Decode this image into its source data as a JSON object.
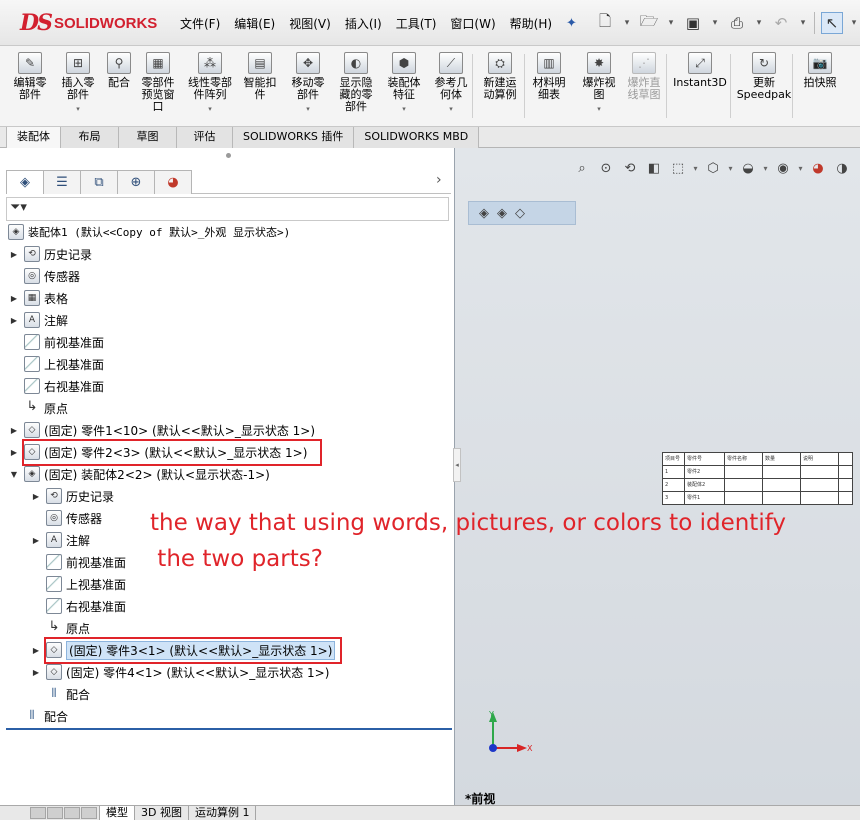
{
  "app": {
    "logo_ds": "DS",
    "logo_name": "SOLIDWORKS"
  },
  "menu": [
    "文件(F)",
    "编辑(E)",
    "视图(V)",
    "插入(I)",
    "工具(T)",
    "窗口(W)",
    "帮助(H)"
  ],
  "commands": [
    {
      "label": "编辑零\n部件",
      "dropdown": false,
      "enabled": true
    },
    {
      "label": "插入零\n部件",
      "dropdown": true,
      "enabled": true
    },
    {
      "label": "配合",
      "dropdown": false,
      "enabled": true
    },
    {
      "label": "零部件\n预览窗\n口",
      "dropdown": false,
      "enabled": true
    },
    {
      "label": "线性零部\n件阵列",
      "dropdown": true,
      "enabled": true
    },
    {
      "label": "智能扣\n件",
      "dropdown": false,
      "enabled": true
    },
    {
      "label": "移动零\n部件",
      "dropdown": true,
      "enabled": true
    },
    {
      "label": "显示隐\n藏的零\n部件",
      "dropdown": false,
      "enabled": true
    },
    {
      "label": "装配体\n特征",
      "dropdown": true,
      "enabled": true
    },
    {
      "label": "参考几\n何体",
      "dropdown": true,
      "enabled": true
    },
    {
      "label": "新建运\n动算例",
      "dropdown": false,
      "enabled": true
    },
    {
      "label": "材料明\n细表",
      "dropdown": false,
      "enabled": true
    },
    {
      "label": "爆炸视\n图",
      "dropdown": true,
      "enabled": true
    },
    {
      "label": "爆炸直\n线草图",
      "dropdown": false,
      "enabled": false
    },
    {
      "label": "Instant3D",
      "dropdown": false,
      "enabled": true
    },
    {
      "label": "更新\nSpeedpak",
      "dropdown": false,
      "enabled": true
    },
    {
      "label": "拍快照",
      "dropdown": false,
      "enabled": true
    }
  ],
  "command_tabs": [
    "装配体",
    "布局",
    "草图",
    "评估",
    "SOLIDWORKS 插件",
    "SOLIDWORKS MBD"
  ],
  "feature_tree": [
    {
      "label": "装配体1  (默认<<Copy of 默认>_外观 显示状态>)",
      "level": 0,
      "expand": "",
      "icon": "assembly-icon",
      "mono": true
    },
    {
      "label": "历史记录",
      "level": 1,
      "expand": "▶",
      "icon": "history-icon"
    },
    {
      "label": "传感器",
      "level": 1,
      "expand": "",
      "icon": "sensor-icon"
    },
    {
      "label": "表格",
      "level": 1,
      "expand": "▶",
      "icon": "table-icon"
    },
    {
      "label": "注解",
      "level": 1,
      "expand": "▶",
      "icon": "annotation-icon"
    },
    {
      "label": "前视基准面",
      "level": 1,
      "expand": "",
      "icon": "plane-icon"
    },
    {
      "label": "上视基准面",
      "level": 1,
      "expand": "",
      "icon": "plane-icon"
    },
    {
      "label": "右视基准面",
      "level": 1,
      "expand": "",
      "icon": "plane-icon"
    },
    {
      "label": "原点",
      "level": 1,
      "expand": "",
      "icon": "origin-icon"
    },
    {
      "label": "(固定) 零件1<10> (默认<<默认>_显示状态 1>)",
      "level": 1,
      "expand": "▶",
      "icon": "part-icon"
    },
    {
      "label": "(固定) 零件2<3> (默认<<默认>_显示状态 1>)",
      "level": 1,
      "expand": "▶",
      "icon": "part-icon",
      "boxed": true
    },
    {
      "label": "(固定) 装配体2<2> (默认<显示状态-1>)",
      "level": 1,
      "expand": "▼",
      "icon": "subassembly-icon"
    },
    {
      "label": "历史记录",
      "level": 2,
      "expand": "▶",
      "icon": "history-icon"
    },
    {
      "label": "传感器",
      "level": 2,
      "expand": "",
      "icon": "sensor-icon"
    },
    {
      "label": "注解",
      "level": 2,
      "expand": "▶",
      "icon": "annotation-icon"
    },
    {
      "label": "前视基准面",
      "level": 2,
      "expand": "",
      "icon": "plane-icon"
    },
    {
      "label": "上视基准面",
      "level": 2,
      "expand": "",
      "icon": "plane-icon"
    },
    {
      "label": "右视基准面",
      "level": 2,
      "expand": "",
      "icon": "plane-icon"
    },
    {
      "label": "原点",
      "level": 2,
      "expand": "",
      "icon": "origin-icon"
    },
    {
      "label": "(固定) 零件3<1> (默认<<默认>_显示状态 1>)",
      "level": 2,
      "expand": "▶",
      "icon": "part-icon",
      "boxed": true,
      "selected": true
    },
    {
      "label": "(固定) 零件4<1> (默认<<默认>_显示状态 1>)",
      "level": 2,
      "expand": "▶",
      "icon": "part-icon"
    },
    {
      "label": "配合",
      "level": 2,
      "expand": "",
      "icon": "mates-icon"
    },
    {
      "label": "配合",
      "level": 1,
      "expand": "",
      "icon": "mates-icon"
    }
  ],
  "bottom_tabs": [
    "模型",
    "3D 视图",
    "运动算例 1"
  ],
  "graphics": {
    "view_label": "*前视",
    "triad_y": "Y",
    "triad_x": "X",
    "bom_rows": [
      [
        "项目号",
        "零件号",
        "零件名称",
        "数量",
        "说明",
        ""
      ],
      [
        "1",
        "零件2",
        "",
        "",
        "",
        ""
      ],
      [
        "2",
        "装配体2",
        "",
        "",
        "",
        ""
      ],
      [
        "3",
        "零件1",
        "",
        "",
        "",
        ""
      ]
    ]
  },
  "annotation": {
    "line1": "the way that using words, pictures, or colors to identify",
    "line2": " the two parts?",
    "color": "#e0242a"
  }
}
